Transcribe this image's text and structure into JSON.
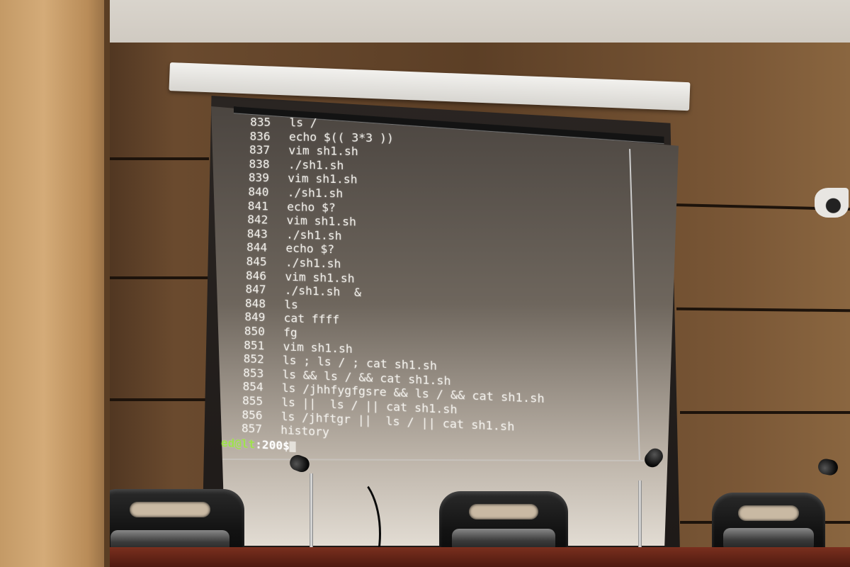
{
  "terminal": {
    "lines": [
      {
        "num": "835",
        "cmd": "ls /"
      },
      {
        "num": "836",
        "cmd": "echo $(( 3*3 ))"
      },
      {
        "num": "837",
        "cmd": "vim sh1.sh"
      },
      {
        "num": "838",
        "cmd": "./sh1.sh"
      },
      {
        "num": "839",
        "cmd": "vim sh1.sh"
      },
      {
        "num": "840",
        "cmd": "./sh1.sh"
      },
      {
        "num": "841",
        "cmd": "echo $?"
      },
      {
        "num": "842",
        "cmd": "vim sh1.sh"
      },
      {
        "num": "843",
        "cmd": "./sh1.sh"
      },
      {
        "num": "844",
        "cmd": "echo $?"
      },
      {
        "num": "845",
        "cmd": "./sh1.sh"
      },
      {
        "num": "846",
        "cmd": "vim sh1.sh"
      },
      {
        "num": "847",
        "cmd": "./sh1.sh  &"
      },
      {
        "num": "848",
        "cmd": "ls"
      },
      {
        "num": "849",
        "cmd": "cat ffff"
      },
      {
        "num": "850",
        "cmd": "fg"
      },
      {
        "num": "851",
        "cmd": "vim sh1.sh"
      },
      {
        "num": "852",
        "cmd": "ls ; ls / ; cat sh1.sh"
      },
      {
        "num": "853",
        "cmd": "ls && ls / && cat sh1.sh"
      },
      {
        "num": "854",
        "cmd": "ls /jhhfygfgsre && ls / && cat sh1.sh"
      },
      {
        "num": "855",
        "cmd": "ls ||  ls / || cat sh1.sh"
      },
      {
        "num": "856",
        "cmd": "ls /jhftgr ||  ls / || cat sh1.sh"
      },
      {
        "num": "857",
        "cmd": "history"
      }
    ],
    "prompt": {
      "user_host": "ed@lt",
      "path": ":200$"
    }
  },
  "colors": {
    "terminal_text": "#f3f1ec",
    "prompt_user": "#9ee04c",
    "wood": "#6a4a2e",
    "desk": "#7a2f1e"
  }
}
